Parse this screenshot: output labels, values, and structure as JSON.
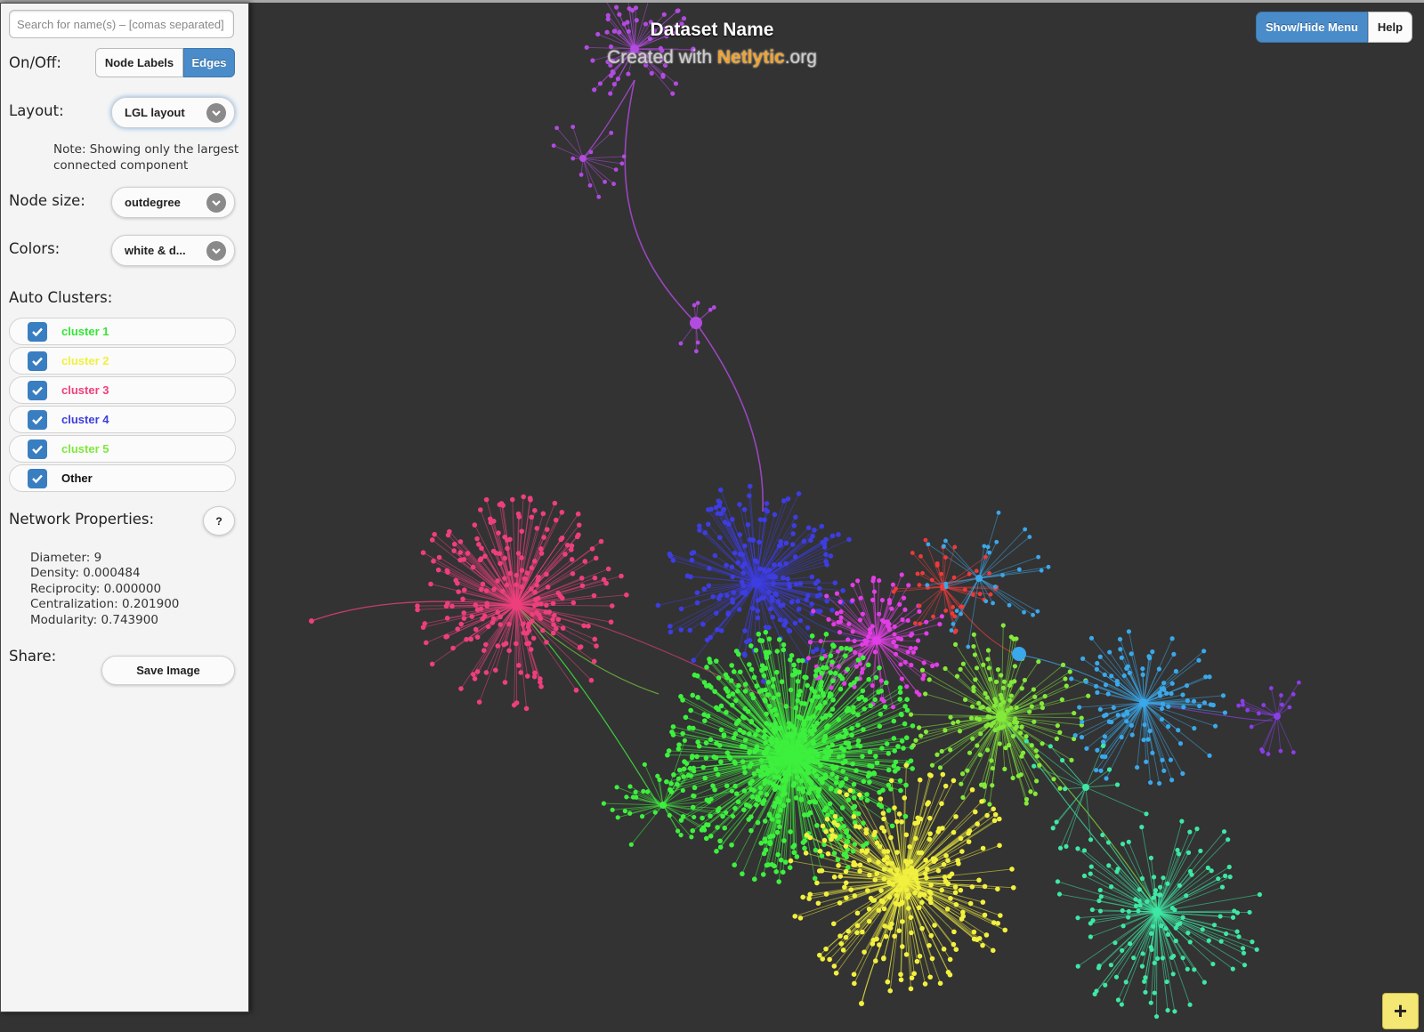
{
  "search": {
    "placeholder": "Search for name(s) – [comas separated]"
  },
  "toggles": {
    "label": "On/Off:",
    "node_labels": "Node Labels",
    "edges": "Edges",
    "edges_active": true
  },
  "layout": {
    "label": "Layout:",
    "value": "LGL layout"
  },
  "note": "Note: Showing only the largest connected component",
  "node_size": {
    "label": "Node size:",
    "value": "outdegree"
  },
  "colors": {
    "label": "Colors:",
    "value": "white & d..."
  },
  "auto_clusters": {
    "label": "Auto Clusters:",
    "items": [
      {
        "label": "cluster 1",
        "color": "#36e536",
        "checked": true
      },
      {
        "label": "cluster 2",
        "color": "#f0f040",
        "checked": true
      },
      {
        "label": "cluster 3",
        "color": "#f0407a",
        "checked": true
      },
      {
        "label": "cluster 4",
        "color": "#3d3ddf",
        "checked": true
      },
      {
        "label": "cluster 5",
        "color": "#7ee83d",
        "checked": true
      },
      {
        "label": "Other",
        "color": "#111111",
        "checked": true
      }
    ]
  },
  "network_properties": {
    "label": "Network Properties:",
    "help": "?",
    "diameter": "Diameter: 9",
    "density": "Density: 0.000484",
    "reciprocity": "Reciprocity: 0.000000",
    "centralization": "Centralization: 0.201900",
    "modularity": "Modularity: 0.743900"
  },
  "share": {
    "label": "Share:",
    "save_image": "Save Image"
  },
  "header": {
    "title": "Dataset Name",
    "created_prefix": "Created with ",
    "brand": "Netlytic",
    "brand_suffix": ".org"
  },
  "top_buttons": {
    "show_hide": "Show/Hide Menu",
    "help": "Help"
  },
  "zoom_button": "+",
  "palette": {
    "purple": "#b24be0",
    "blue": "#3d3de0",
    "pink": "#ee3f7d",
    "green": "#3ef03e",
    "lime": "#84ea3a",
    "yellow": "#f2f03e",
    "teal": "#3ee8a4",
    "lightblue": "#3aa8ea",
    "magenta": "#e23ee6",
    "red": "#ee3a3a",
    "violet": "#8a3ee8",
    "background": "#333333"
  }
}
